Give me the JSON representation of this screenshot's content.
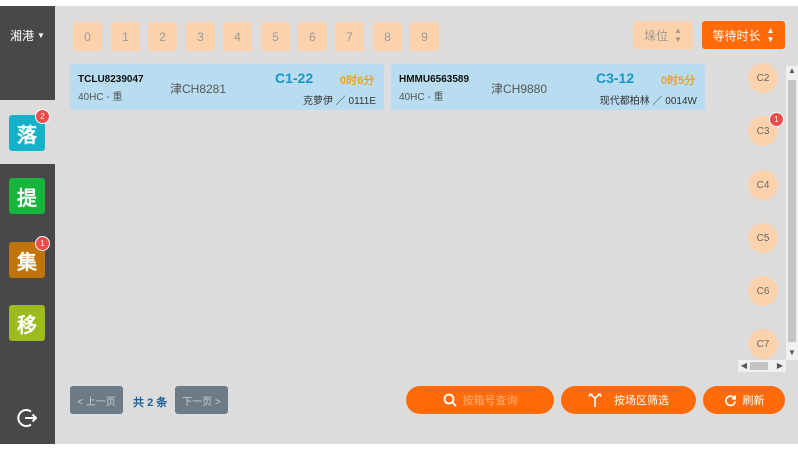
{
  "sidebar": {
    "port": "湘港",
    "nav": [
      {
        "label": "落",
        "badge": "2",
        "color": "#14b1c8"
      },
      {
        "label": "提",
        "badge": "",
        "color": "#17b63a"
      },
      {
        "label": "集",
        "badge": "1",
        "color": "#c0740a"
      },
      {
        "label": "移",
        "badge": "",
        "color": "#9dbb1c"
      }
    ]
  },
  "filters": {
    "digits": [
      "0",
      "1",
      "2",
      "3",
      "4",
      "5",
      "6",
      "7",
      "8",
      "9"
    ],
    "sort_slot": "垛位",
    "sort_wait": "等待时长"
  },
  "cards": [
    {
      "container": "TCLU8239047",
      "type": "40HC - 重",
      "truck": "津CH8281",
      "slot": "C1-22",
      "wait": "0时6分",
      "owner": "克萝伊 ／ 0111E"
    },
    {
      "container": "HMMU6563589",
      "type": "40HC - 重",
      "truck": "津CH9880",
      "slot": "C3-12",
      "wait": "0时5分",
      "owner": "现代都柏林 ／ 0014W"
    }
  ],
  "zones": [
    {
      "label": "C2",
      "badge": ""
    },
    {
      "label": "C3",
      "badge": "1"
    },
    {
      "label": "C4",
      "badge": ""
    },
    {
      "label": "C5",
      "badge": ""
    },
    {
      "label": "C6",
      "badge": ""
    },
    {
      "label": "C7",
      "badge": ""
    }
  ],
  "pager": {
    "prev": "< 上一页",
    "total_prefix": "共",
    "total_count": "2",
    "total_suffix": "条",
    "next": "下一页 >"
  },
  "actions": {
    "search_placeholder": "按箱号查询",
    "zone_filter": "按场区筛选",
    "refresh": "刷新"
  },
  "colors": {
    "accent": "#ff6a0a",
    "digit_bg": "#fcd2ad",
    "card_bg": "#b9ddf0",
    "slot_text": "#1497c7",
    "wait_text": "#f0a020"
  }
}
